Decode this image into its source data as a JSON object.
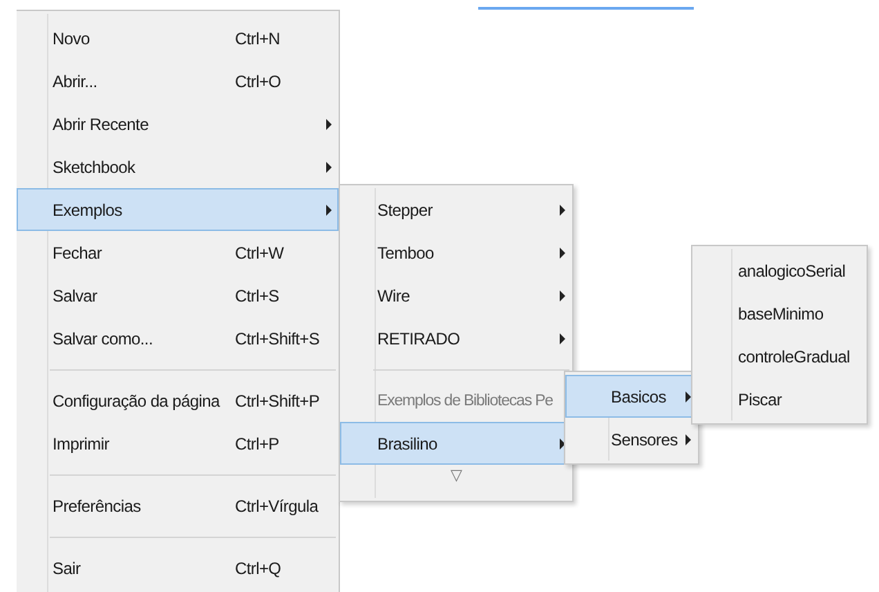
{
  "menus": [
    {
      "items": [
        {
          "kind": "item",
          "label": "Novo",
          "shortcut": "Ctrl+N",
          "submenu": false,
          "selected": false
        },
        {
          "kind": "item",
          "label": "Abrir...",
          "shortcut": "Ctrl+O",
          "submenu": false,
          "selected": false
        },
        {
          "kind": "item",
          "label": "Abrir Recente",
          "submenu": true,
          "selected": false
        },
        {
          "kind": "item",
          "label": "Sketchbook",
          "submenu": true,
          "selected": false
        },
        {
          "kind": "item",
          "label": "Exemplos",
          "submenu": true,
          "selected": true
        },
        {
          "kind": "item",
          "label": "Fechar",
          "shortcut": "Ctrl+W",
          "submenu": false,
          "selected": false
        },
        {
          "kind": "item",
          "label": "Salvar",
          "shortcut": "Ctrl+S",
          "submenu": false,
          "selected": false
        },
        {
          "kind": "item",
          "label": "Salvar como...",
          "shortcut": "Ctrl+Shift+S",
          "submenu": false,
          "selected": false
        },
        {
          "kind": "separator"
        },
        {
          "kind": "item",
          "label": "Configuração da página",
          "shortcut": "Ctrl+Shift+P",
          "submenu": false,
          "selected": false
        },
        {
          "kind": "item",
          "label": "Imprimir",
          "shortcut": "Ctrl+P",
          "submenu": false,
          "selected": false
        },
        {
          "kind": "separator"
        },
        {
          "kind": "item",
          "label": "Preferências",
          "shortcut": "Ctrl+Vírgula",
          "submenu": false,
          "selected": false
        },
        {
          "kind": "separator"
        },
        {
          "kind": "item",
          "label": "Sair",
          "shortcut": "Ctrl+Q",
          "submenu": false,
          "selected": false
        }
      ]
    },
    {
      "items": [
        {
          "kind": "item",
          "label": "Stepper",
          "submenu": true,
          "selected": false,
          "disabled": false
        },
        {
          "kind": "item",
          "label": "Temboo",
          "submenu": true,
          "selected": false,
          "disabled": false
        },
        {
          "kind": "item",
          "label": "Wire",
          "submenu": true,
          "selected": false,
          "disabled": false
        },
        {
          "kind": "item",
          "label": "RETIRADO",
          "submenu": true,
          "selected": false,
          "disabled": false
        },
        {
          "kind": "separator"
        },
        {
          "kind": "item",
          "label": "Exemplos de Bibliotecas Pe",
          "submenu": false,
          "selected": false,
          "disabled": true
        },
        {
          "kind": "item",
          "label": "Brasilino",
          "submenu": true,
          "selected": true,
          "disabled": false
        },
        {
          "kind": "scroll",
          "label": "▽"
        }
      ]
    },
    {
      "items": [
        {
          "kind": "item",
          "label": "Basicos",
          "submenu": true,
          "selected": true
        },
        {
          "kind": "item",
          "label": "Sensores",
          "submenu": true,
          "selected": false
        }
      ]
    },
    {
      "items": [
        {
          "kind": "item",
          "label": "analogicoSerial",
          "selected": false
        },
        {
          "kind": "item",
          "label": "baseMinimo",
          "selected": false
        },
        {
          "kind": "item",
          "label": "controleGradual",
          "selected": false
        },
        {
          "kind": "item",
          "label": "Piscar",
          "selected": false
        }
      ]
    }
  ]
}
